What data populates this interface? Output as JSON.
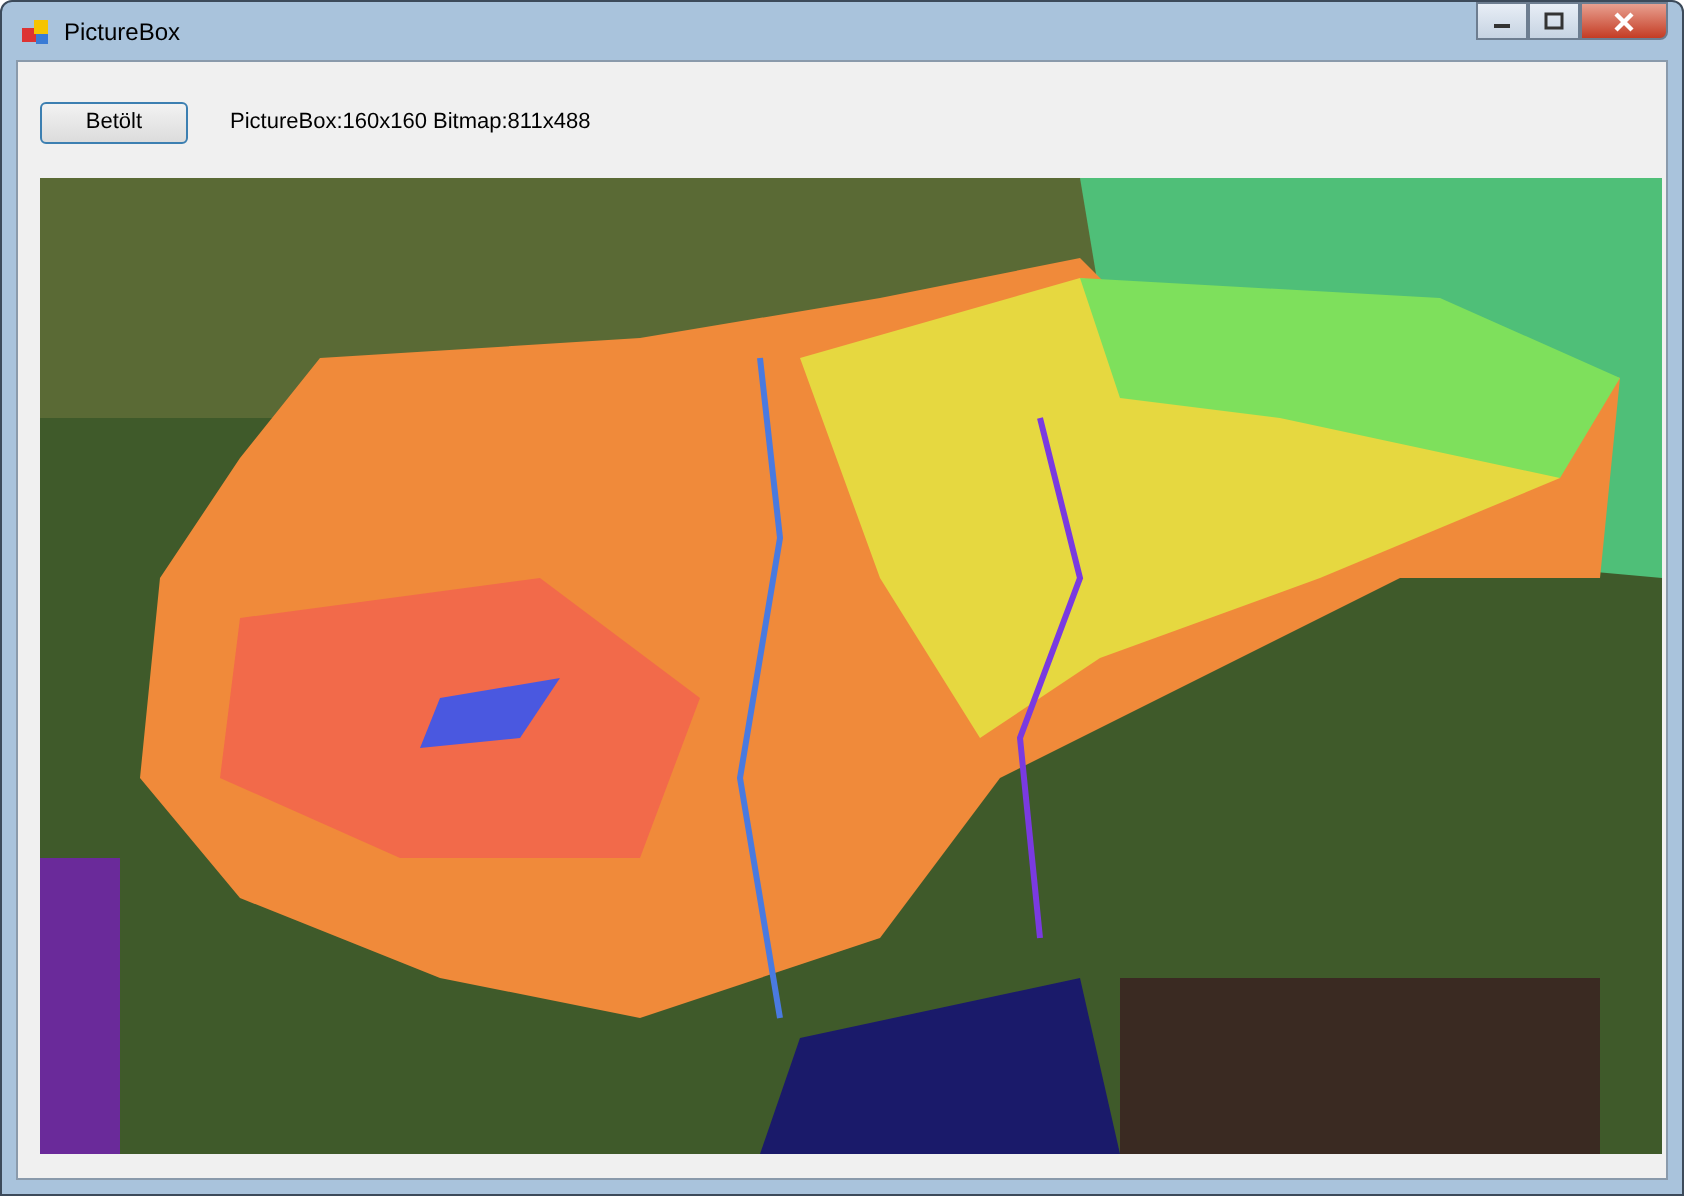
{
  "window": {
    "title": "PictureBox"
  },
  "load_button": {
    "label": "Betölt"
  },
  "info_label": "PictureBox:160x160 Bitmap:811x488"
}
